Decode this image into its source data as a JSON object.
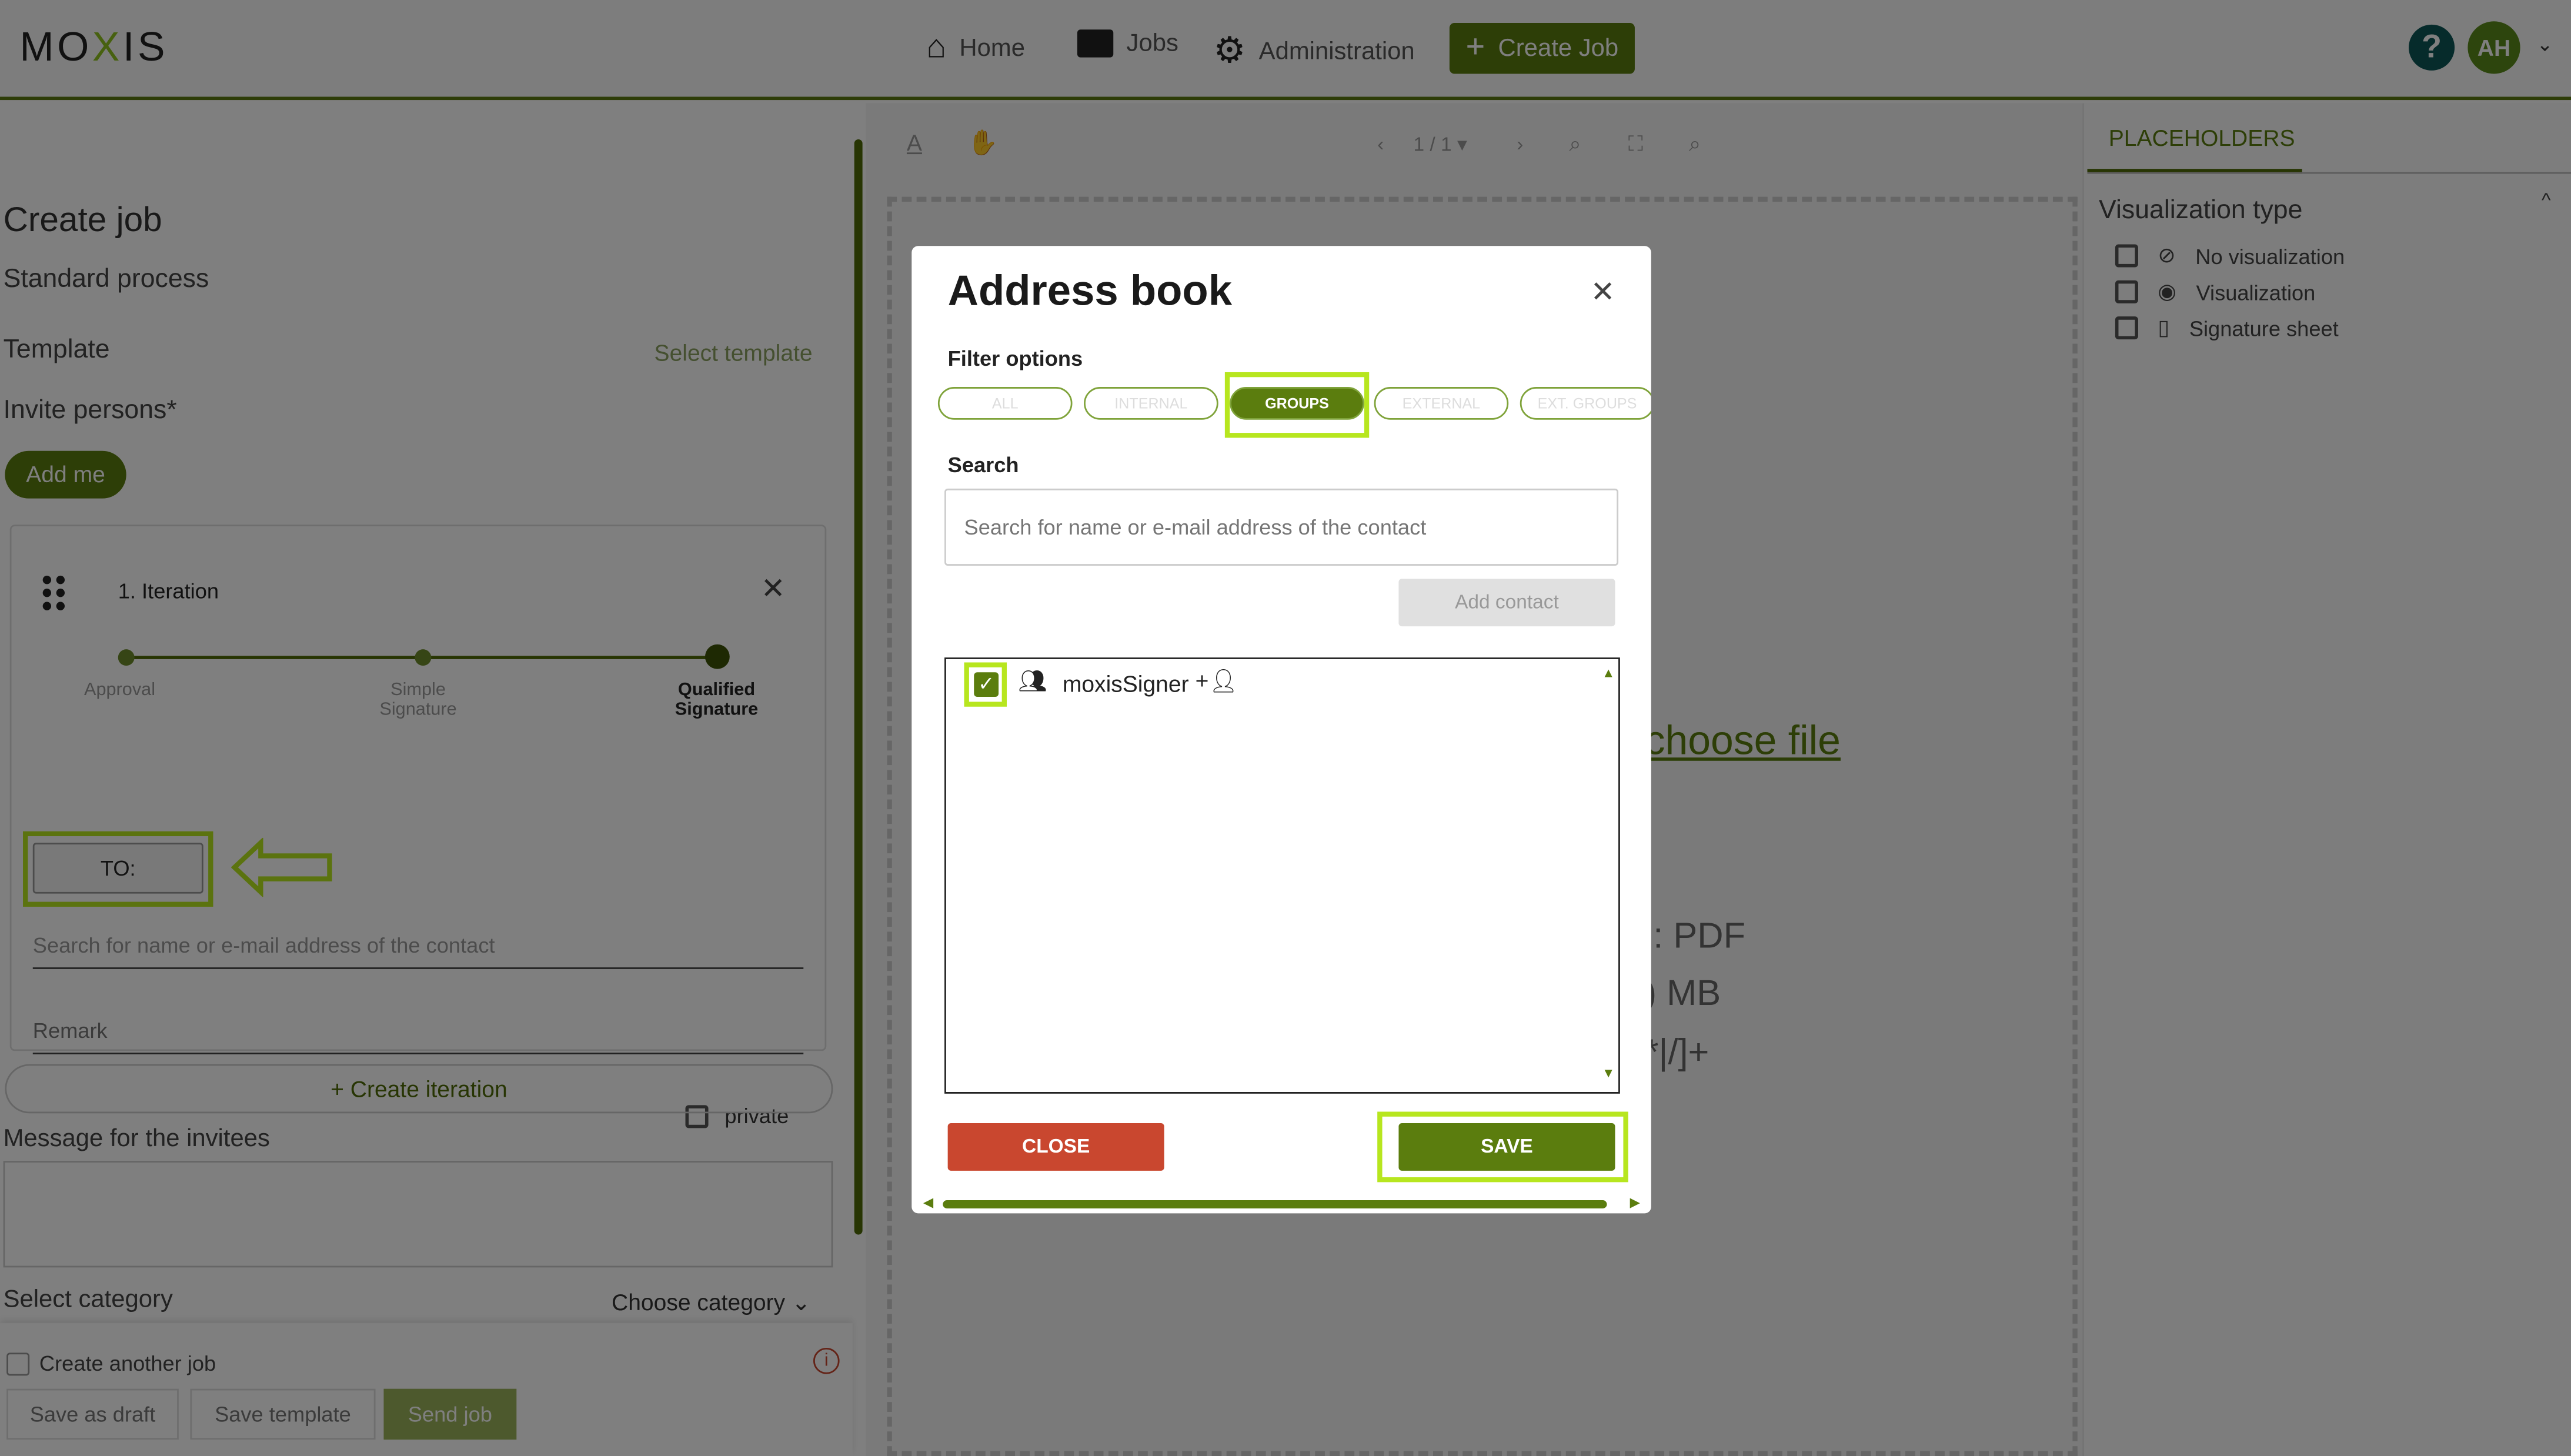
{
  "header": {
    "logo": "MOXIS",
    "nav": [
      {
        "label": "Home",
        "icon": "home-icon"
      },
      {
        "label": "Jobs",
        "icon": "folder-icon"
      },
      {
        "label": "Administration",
        "icon": "gear-icon"
      }
    ],
    "create_job": "Create Job",
    "help": "?",
    "avatar": "AH"
  },
  "left": {
    "title": "Create job",
    "subtitle": "Standard process",
    "template_label": "Template",
    "select_template": "Select template",
    "invite_label": "Invite persons*",
    "add_me": "Add me",
    "iteration": {
      "title": "1. Iteration",
      "steps": [
        "Approval",
        "Simple Signature",
        "Qualified Signature"
      ],
      "active_step": "Qualified Signature",
      "to_button": "TO:",
      "search_placeholder": "Search for name or e-mail address of the contact",
      "remark_placeholder": "Remark",
      "private_label": "private"
    },
    "create_iteration": "Create iteration",
    "message_label": "Message for the invitees",
    "category_label": "Select category",
    "category_value": "Choose category",
    "create_another": "Create another job",
    "save_draft": "Save as draft",
    "save_template": "Save template",
    "send_job": "Send job"
  },
  "center": {
    "page_indicator": "1 / 1",
    "choose_file": "choose file",
    "hint_lines": [
      "d: PDF",
      ") MB",
      "*|/]+"
    ]
  },
  "right": {
    "tab": "PLACEHOLDERS",
    "section": "Visualization type",
    "options": [
      "No visualization",
      "Visualization",
      "Signature sheet"
    ]
  },
  "modal": {
    "title": "Address book",
    "filter_label": "Filter options",
    "filters": [
      "ALL",
      "INTERNAL",
      "GROUPS",
      "EXTERNAL",
      "EXT. GROUPS"
    ],
    "active_filter": "GROUPS",
    "search_label": "Search",
    "search_placeholder": "Search for name or e-mail address of the contact",
    "add_contact": "Add contact",
    "contacts": [
      {
        "name": "moxisSigner",
        "checked": true
      }
    ],
    "close": "CLOSE",
    "save": "SAVE"
  },
  "colors": {
    "brand": "#5b7d0e",
    "highlight": "#b7e61f",
    "danger": "#c9472f"
  }
}
